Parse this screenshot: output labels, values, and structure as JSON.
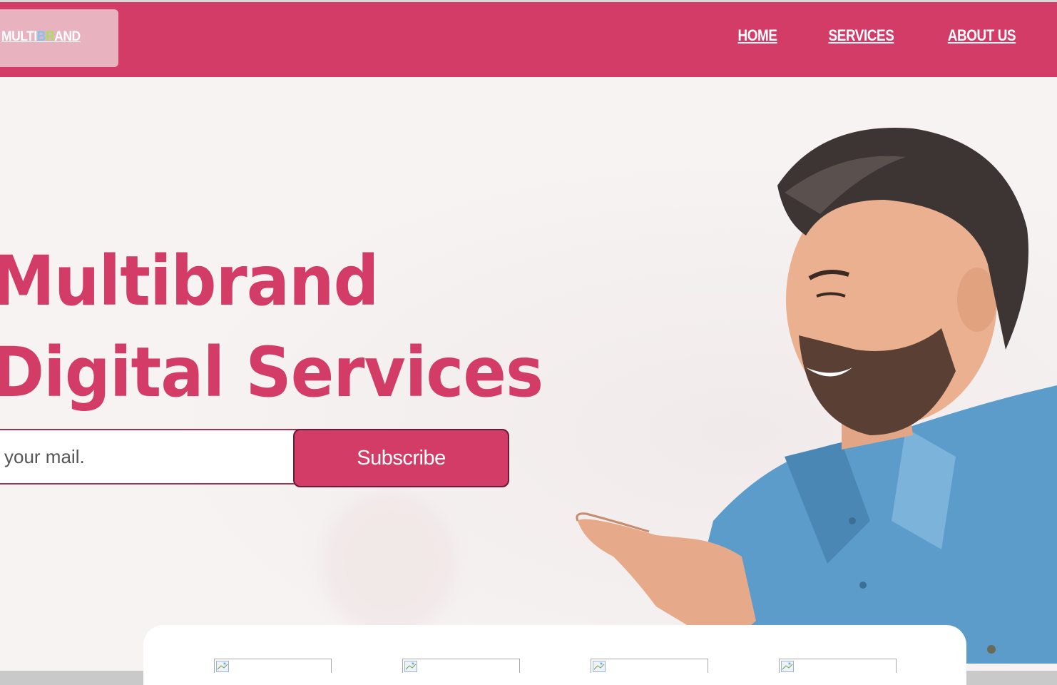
{
  "brand": {
    "parts": [
      "MULTI",
      "B",
      "R",
      "AND"
    ]
  },
  "nav": {
    "items": [
      "HOME",
      "SERVICES",
      "ABOUT US"
    ]
  },
  "hero": {
    "title_line1": "Multibrand",
    "title_line2": "Digital Services"
  },
  "subscribe": {
    "placeholder": "your mail.",
    "button_label": "Subscribe"
  },
  "colors": {
    "brand": "#d23c67",
    "background": "#f7f3f3"
  },
  "thumbnails": [
    {
      "icon": "broken-image-icon"
    },
    {
      "icon": "broken-image-icon"
    },
    {
      "icon": "broken-image-icon"
    },
    {
      "icon": "broken-image-icon"
    }
  ]
}
